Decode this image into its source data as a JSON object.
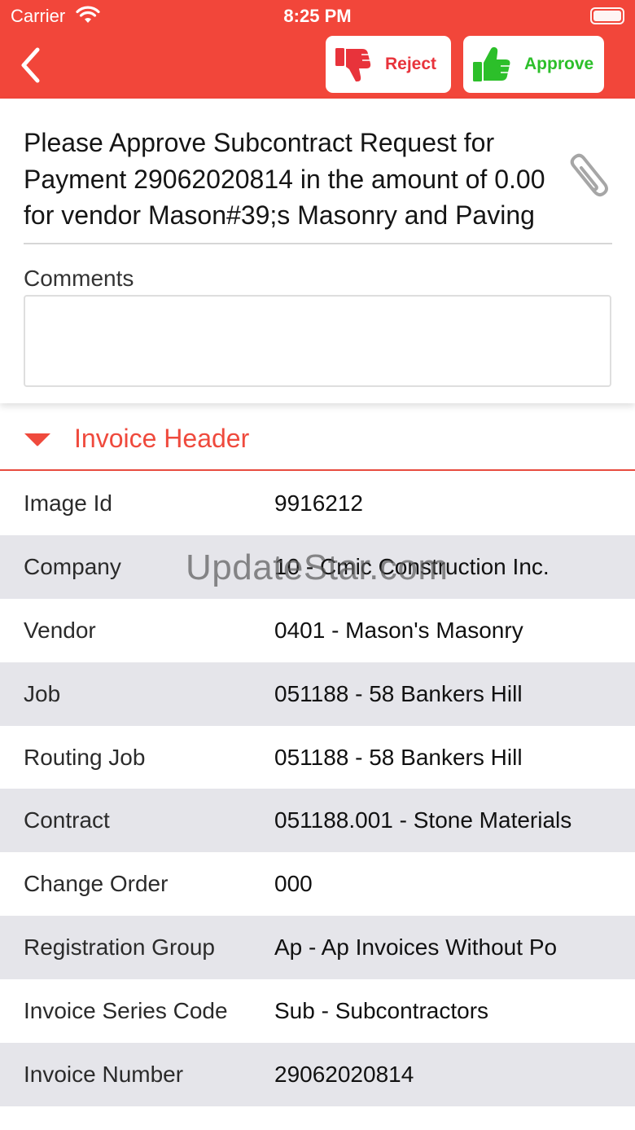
{
  "status_bar": {
    "carrier": "Carrier",
    "time": "8:25 PM"
  },
  "toolbar": {
    "reject_label": "Reject",
    "approve_label": "Approve"
  },
  "message": "Please Approve Subcontract Request for Payment 29062020814 in the amount of 0.00 for vendor Mason#39;s Masonry and Paving",
  "comments": {
    "label": "Comments",
    "value": ""
  },
  "section": {
    "title": "Invoice Header"
  },
  "rows": [
    {
      "label": "Image Id",
      "value": "9916212"
    },
    {
      "label": "Company",
      "value": "10 - Cmic Construction Inc."
    },
    {
      "label": "Vendor",
      "value": "0401 - Mason's Masonry"
    },
    {
      "label": "Job",
      "value": "051188 - 58 Bankers Hill"
    },
    {
      "label": "Routing Job",
      "value": "051188 - 58 Bankers Hill"
    },
    {
      "label": "Contract",
      "value": "051188.001 - Stone Materials"
    },
    {
      "label": "Change Order",
      "value": "000"
    },
    {
      "label": "Registration Group",
      "value": "Ap - Ap Invoices Without Po"
    },
    {
      "label": "Invoice Series Code",
      "value": "Sub - Subcontractors"
    },
    {
      "label": "Invoice Number",
      "value": "29062020814"
    }
  ],
  "watermark": "UpdateStar.com",
  "colors": {
    "accent": "#f2463a",
    "reject": "#e8333b",
    "approve": "#2cbf2a",
    "stripe": "#e5e5ea"
  },
  "icons": [
    "back-chevron-icon",
    "thumbs-down-icon",
    "thumbs-up-icon",
    "paperclip-icon",
    "caret-down-icon",
    "wifi-icon",
    "battery-icon"
  ]
}
